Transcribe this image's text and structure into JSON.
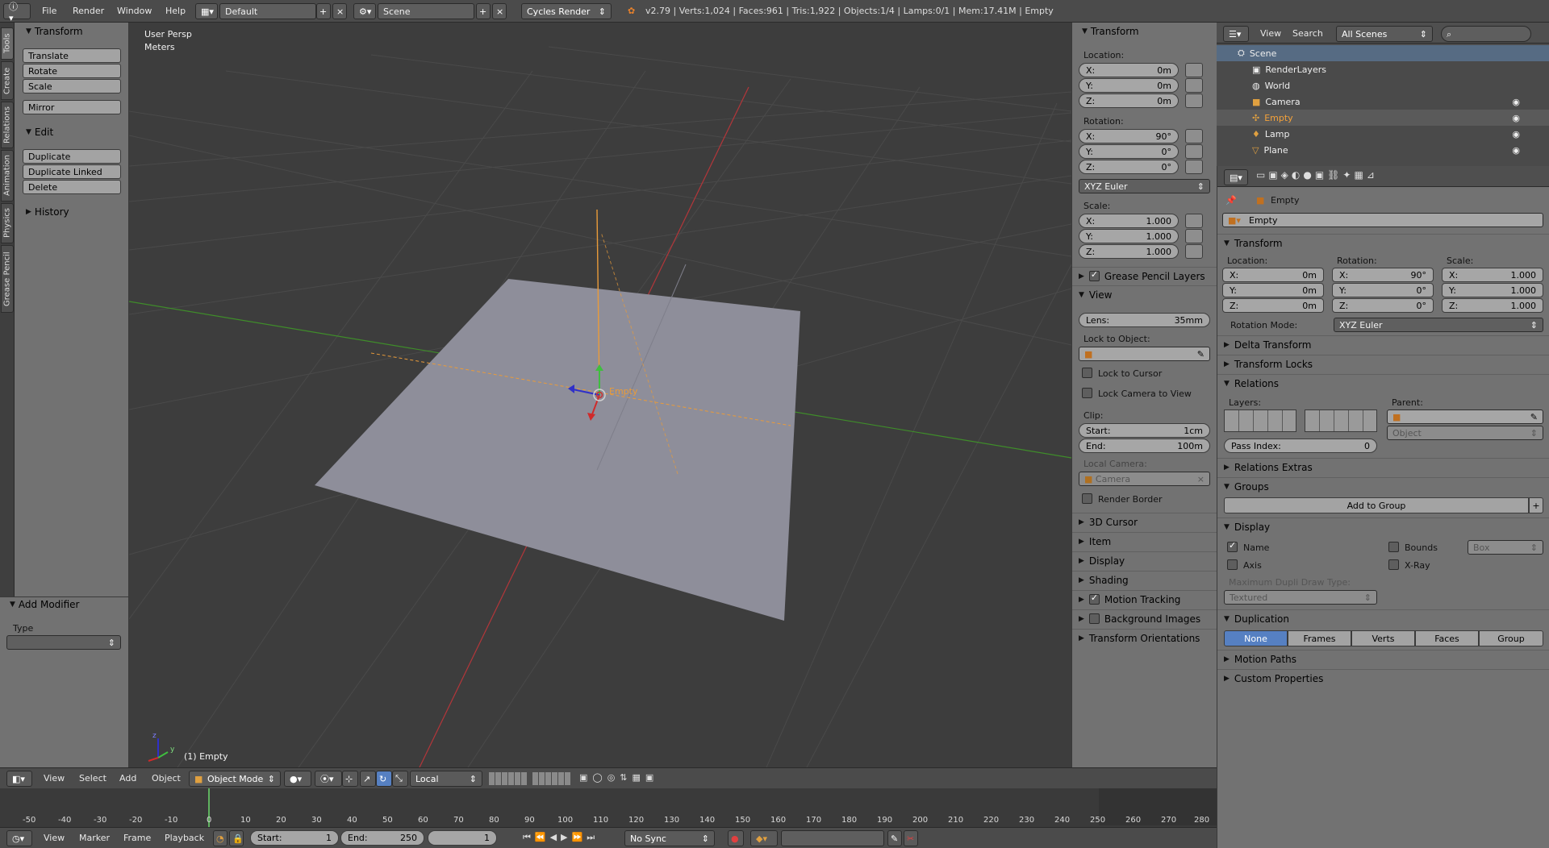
{
  "topbar": {
    "menus": [
      "File",
      "Render",
      "Window",
      "Help"
    ],
    "layout": "Default",
    "scene": "Scene",
    "engine": "Cycles Render",
    "info": "v2.79 | Verts:1,024 | Faces:961 | Tris:1,922 | Objects:1/4 | Lamps:0/1 | Mem:17.41M | Empty"
  },
  "tool_tabs": [
    "Tools",
    "Create",
    "Relations",
    "Animation",
    "Physics",
    "Grease Pencil"
  ],
  "tools": {
    "transform_header": "Transform",
    "transform_buttons": [
      "Translate",
      "Rotate",
      "Scale",
      "Mirror"
    ],
    "edit_header": "Edit",
    "edit_buttons": [
      "Duplicate",
      "Duplicate Linked",
      "Delete"
    ],
    "history_header": "History",
    "add_modifier_header": "Add Modifier",
    "type_label": "Type"
  },
  "viewport": {
    "view_name": "User Persp",
    "units": "Meters",
    "object_label": "(1) Empty",
    "empty_label": "Empty",
    "axis_labels": [
      "z",
      "y"
    ],
    "colors": {
      "x_axis": "#b3363a",
      "y_axis": "#3f8d2a",
      "plane": "#8e8e9a",
      "empty": "#e99b3a"
    }
  },
  "npanel": {
    "transform_header": "Transform",
    "location_label": "Location:",
    "location": [
      {
        "axis": "X:",
        "value": "0m"
      },
      {
        "axis": "Y:",
        "value": "0m"
      },
      {
        "axis": "Z:",
        "value": "0m"
      }
    ],
    "rotation_label": "Rotation:",
    "rotation": [
      {
        "axis": "X:",
        "value": "90°"
      },
      {
        "axis": "Y:",
        "value": "0°"
      },
      {
        "axis": "Z:",
        "value": "0°"
      }
    ],
    "rotation_mode": "XYZ Euler",
    "scale_label": "Scale:",
    "scale": [
      {
        "axis": "X:",
        "value": "1.000"
      },
      {
        "axis": "Y:",
        "value": "1.000"
      },
      {
        "axis": "Z:",
        "value": "1.000"
      }
    ],
    "grease_pencil": "Grease Pencil Layers",
    "view_header": "View",
    "lens_label": "Lens:",
    "lens_value": "35mm",
    "lock_object_label": "Lock to Object:",
    "lock_cursor": "Lock to Cursor",
    "lock_camera": "Lock Camera to View",
    "clip_label": "Clip:",
    "clip_start_label": "Start:",
    "clip_start": "1cm",
    "clip_end_label": "End:",
    "clip_end": "100m",
    "local_camera_label": "Local Camera:",
    "local_camera": "Camera",
    "render_border": "Render Border",
    "sections": [
      "3D Cursor",
      "Item",
      "Display",
      "Shading",
      "Motion Tracking",
      "Background Images",
      "Transform Orientations"
    ]
  },
  "outliner": {
    "menus": [
      "View",
      "Search"
    ],
    "filter": "All Scenes",
    "rows": [
      "Scene",
      "RenderLayers",
      "World",
      "Camera",
      "Empty",
      "Lamp",
      "Plane"
    ]
  },
  "properties": {
    "breadcrumb": "Empty",
    "object_name": "Empty",
    "transform_header": "Transform",
    "location_label": "Location:",
    "rotation_label": "Rotation:",
    "scale_label": "Scale:",
    "loc": [
      {
        "axis": "X:",
        "value": "0m"
      },
      {
        "axis": "Y:",
        "value": "0m"
      },
      {
        "axis": "Z:",
        "value": "0m"
      }
    ],
    "rot": [
      {
        "axis": "X:",
        "value": "90°"
      },
      {
        "axis": "Y:",
        "value": "0°"
      },
      {
        "axis": "Z:",
        "value": "0°"
      }
    ],
    "scl": [
      {
        "axis": "X:",
        "value": "1.000"
      },
      {
        "axis": "Y:",
        "value": "1.000"
      },
      {
        "axis": "Z:",
        "value": "1.000"
      }
    ],
    "rotation_mode_label": "Rotation Mode:",
    "rotation_mode": "XYZ Euler",
    "delta_transform": "Delta Transform",
    "transform_locks": "Transform Locks",
    "relations_header": "Relations",
    "layers_label": "Layers:",
    "parent_label": "Parent:",
    "parent_type": "Object",
    "pass_index_label": "Pass Index:",
    "pass_index": "0",
    "relations_extras": "Relations Extras",
    "groups_header": "Groups",
    "add_to_group": "Add to Group",
    "display_header": "Display",
    "name": "Name",
    "axis": "Axis",
    "bounds": "Bounds",
    "xray": "X-Ray",
    "bounds_type": "Box",
    "max_dupli_label": "Maximum Dupli Draw Type:",
    "max_dupli": "Textured",
    "duplication_header": "Duplication",
    "duplication_options": [
      "None",
      "Frames",
      "Verts",
      "Faces",
      "Group"
    ],
    "motion_paths": "Motion Paths",
    "custom_properties": "Custom Properties"
  },
  "view3d_header": {
    "menus": [
      "View",
      "Select",
      "Add",
      "Object"
    ],
    "mode": "Object Mode",
    "orientation": "Local"
  },
  "timeline": {
    "ticks": [
      "-50",
      "-40",
      "-30",
      "-20",
      "-10",
      "0",
      "10",
      "20",
      "30",
      "40",
      "50",
      "60",
      "70",
      "80",
      "90",
      "100",
      "110",
      "120",
      "130",
      "140",
      "150",
      "160",
      "170",
      "180",
      "190",
      "200",
      "210",
      "220",
      "230",
      "240",
      "250",
      "260",
      "270",
      "280"
    ],
    "menus": [
      "View",
      "Marker",
      "Frame",
      "Playback"
    ],
    "start_label": "Start:",
    "start": "1",
    "end_label": "End:",
    "end": "250",
    "current": "1",
    "sync": "No Sync"
  }
}
